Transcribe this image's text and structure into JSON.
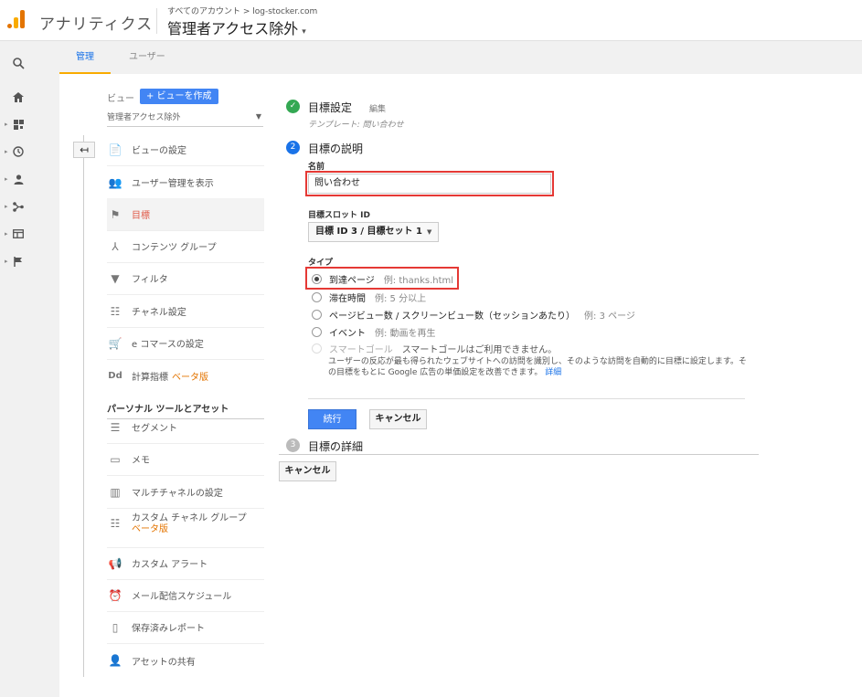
{
  "header": {
    "app_title": "アナリティクス",
    "breadcrumb": "すべてのアカウント > log-stocker.com",
    "view_name": "管理者アクセス除外",
    "view_caret": "▾"
  },
  "rail": {
    "icons": [
      "search-icon",
      "home-icon",
      "dashboard-icon",
      "clock-icon",
      "person-icon",
      "acquisition-icon",
      "behavior-icon",
      "flag-icon"
    ]
  },
  "tabs": [
    {
      "label": "管理"
    },
    {
      "label": "ユーザー"
    }
  ],
  "nav": {
    "back_glyph": "↤",
    "view_label": "ビュー",
    "create_view_label": "+ ビューを作成",
    "view_select_value": "管理者アクセス除外",
    "items": [
      {
        "label": "ビューの設定",
        "icon": "📄"
      },
      {
        "label": "ユーザー管理を表示",
        "icon": "👥"
      },
      {
        "label": "目標",
        "icon": "⚑"
      },
      {
        "label": "コンテンツ グループ",
        "icon": "⅄"
      },
      {
        "label": "フィルタ",
        "icon": "▼"
      },
      {
        "label": "チャネル設定",
        "icon": "☷"
      },
      {
        "label": "e コマースの設定",
        "icon": "🛒"
      },
      {
        "label": "計算指標",
        "beta": "ベータ版",
        "icon": "Dd"
      }
    ],
    "section_title": "パーソナル ツールとアセット",
    "items2": [
      {
        "label": "セグメント",
        "icon": "☰"
      },
      {
        "label": "メモ",
        "icon": "▭"
      },
      {
        "label": "マルチチャネルの設定",
        "icon": "▥"
      },
      {
        "label": "カスタム チャネル グループ",
        "beta": "ベータ版",
        "icon": "☷"
      },
      {
        "label": "カスタム アラート",
        "icon": "📢"
      },
      {
        "label": "メール配信スケジュール",
        "icon": "⏰"
      },
      {
        "label": "保存済みレポート",
        "icon": "▯"
      },
      {
        "label": "アセットの共有",
        "icon": "👤"
      }
    ]
  },
  "goal": {
    "step1": {
      "number": "✓",
      "title": "目標設定",
      "edit": "編集",
      "template": "テンプレート: 問い合わせ"
    },
    "step2": {
      "number": "2",
      "title": "目標の説明",
      "name_label": "名前",
      "name_value": "問い合わせ",
      "slot_label": "目標スロット ID",
      "slot_value": "目標 ID 3 / 目標セット 1",
      "type_label": "タイプ",
      "types": [
        {
          "label": "到達ページ",
          "example": "例: thanks.html",
          "checked": true
        },
        {
          "label": "滞在時間",
          "example": "例: 5 分以上"
        },
        {
          "label": "ページビュー数 / スクリーンビュー数（セッションあたり）",
          "example": "例: 3 ページ"
        },
        {
          "label": "イベント",
          "example": "例: 動画を再生"
        },
        {
          "label": "スマートゴール",
          "note": "スマートゴールはご利用できません。",
          "disabled": true
        }
      ],
      "smart_desc": "ユーザーの反応が最も得られたウェブサイトへの訪問を識別し、そのような訪問を自動的に目標に設定します。その目標をもとに Google 広告の単価設定を改善できます。",
      "smart_link": "詳細",
      "continue": "続行",
      "cancel": "キャンセル"
    },
    "step3": {
      "number": "3",
      "title": "目標の詳細"
    },
    "cancel_bottom": "キャンセル"
  },
  "colors": {
    "accent_blue": "#4285f4",
    "active_red": "#e05b4a",
    "beta_orange": "#e37400",
    "step_done": "#34a853",
    "step_current": "#1a73e8",
    "step_pending": "#bbbbbb",
    "highlight_red": "#e53935"
  }
}
